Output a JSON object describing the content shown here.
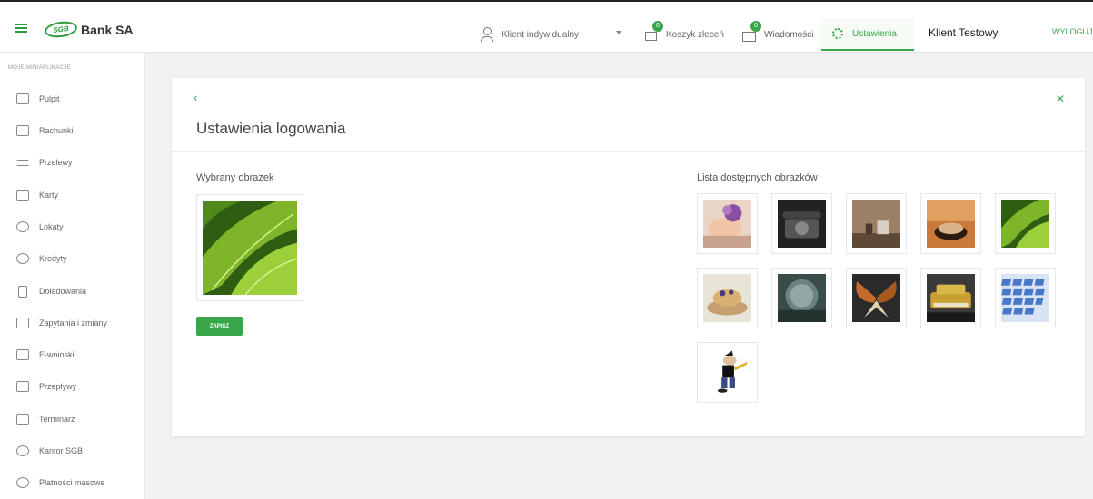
{
  "header": {
    "logo_badge": "SGB",
    "logo_text": "Bank SA",
    "nav": {
      "client_type": "Klient indywidualny",
      "basket": "Koszyk zleceń",
      "basket_count": "0",
      "messages": "Wiadomości",
      "messages_count": "0",
      "settings": "Ustawienia"
    },
    "client_name": "Klient Testowy",
    "logout": "WYLOGUJ"
  },
  "sidebar": {
    "heading": "MOJE MINIAPLIKACJE",
    "items": [
      {
        "label": "Pulpit",
        "icon": "desktop-icon"
      },
      {
        "label": "Rachunki",
        "icon": "accounts-icon"
      },
      {
        "label": "Przelewy",
        "icon": "transfers-icon"
      },
      {
        "label": "Karty",
        "icon": "card-icon"
      },
      {
        "label": "Lokaty",
        "icon": "deposit-icon"
      },
      {
        "label": "Kredyty",
        "icon": "credit-icon"
      },
      {
        "label": "Doładowania",
        "icon": "phone-icon"
      },
      {
        "label": "Zapytania i zmiany",
        "icon": "inquiries-icon"
      },
      {
        "label": "E-wnioski",
        "icon": "forms-icon"
      },
      {
        "label": "Przepływy",
        "icon": "flows-icon"
      },
      {
        "label": "Terminarz",
        "icon": "calendar-icon"
      },
      {
        "label": "Kantor SGB",
        "icon": "exchange-icon"
      },
      {
        "label": "Płatności masowe",
        "icon": "bulk-payments-icon"
      }
    ]
  },
  "main": {
    "title": "Ustawienia logowania",
    "selected_label": "Wybrany obrazek",
    "save_button": "ZAPISZ",
    "list_label": "Lista dostępnych obrazków"
  },
  "colors": {
    "accent": "#3aa64a",
    "background": "#f2f2f2"
  }
}
